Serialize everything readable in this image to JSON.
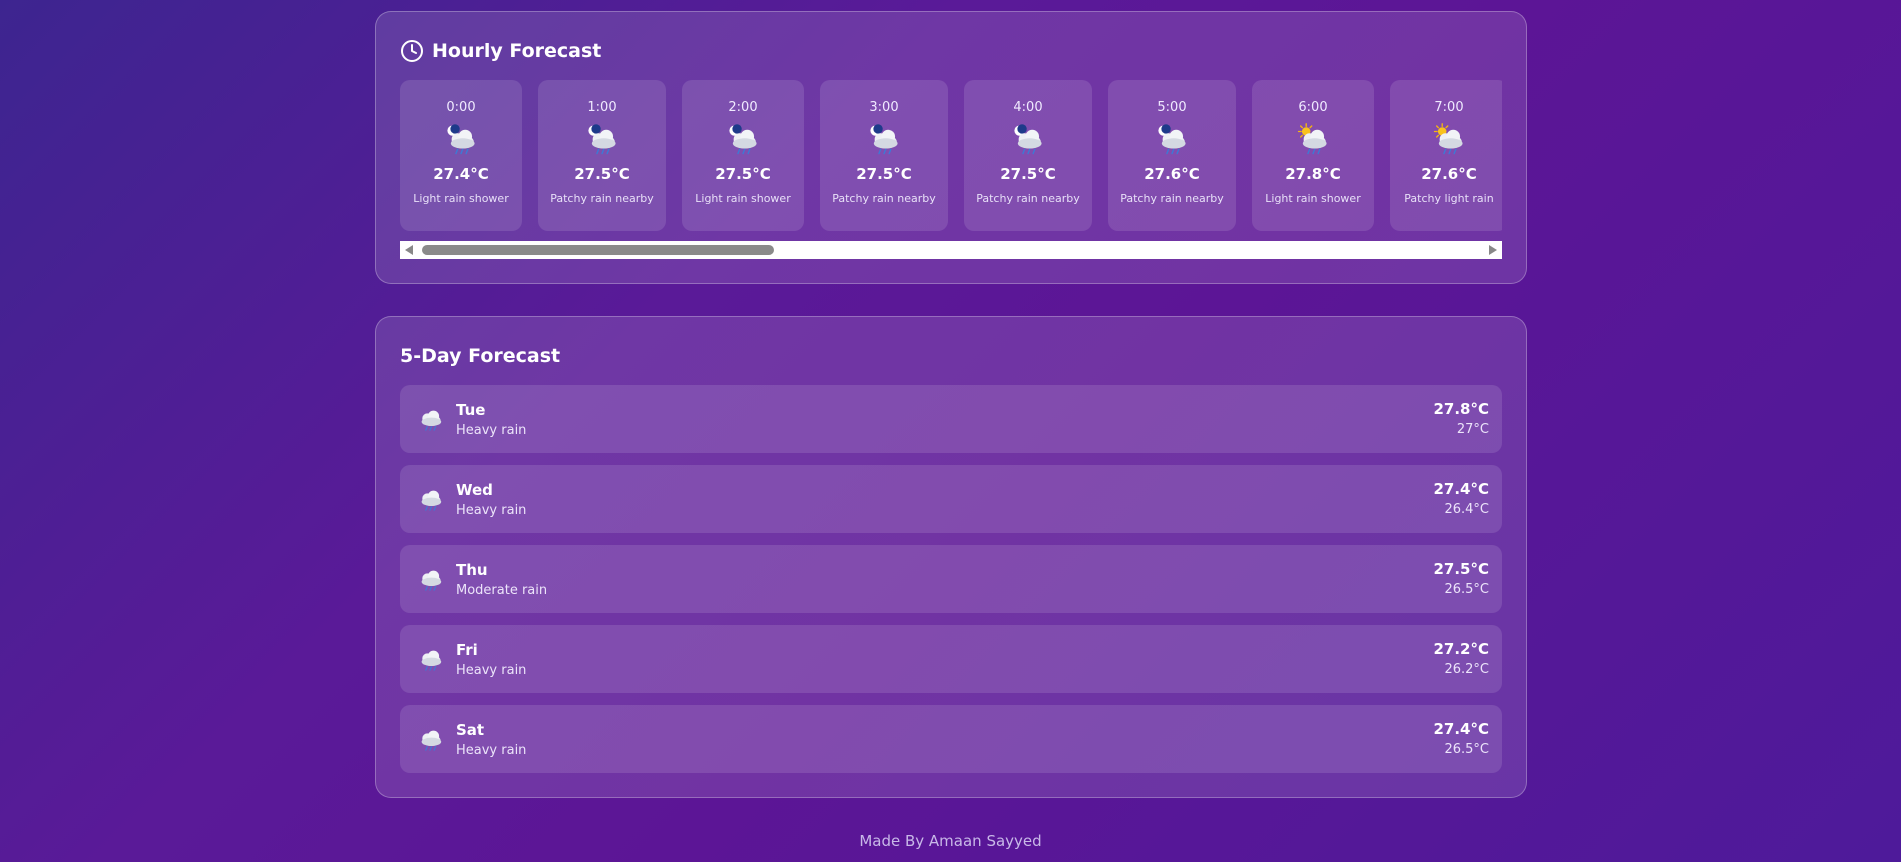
{
  "hourly": {
    "title": "Hourly Forecast",
    "title_icon": "clock-icon",
    "items": [
      {
        "time": "0:00",
        "icon": "moon-cloud-rain-icon",
        "temp": "27.4°C",
        "condition": "Light rain shower"
      },
      {
        "time": "1:00",
        "icon": "moon-cloud-rain-icon",
        "temp": "27.5°C",
        "condition": "Patchy rain nearby"
      },
      {
        "time": "2:00",
        "icon": "moon-cloud-rain-icon",
        "temp": "27.5°C",
        "condition": "Light rain shower"
      },
      {
        "time": "3:00",
        "icon": "moon-cloud-rain-icon",
        "temp": "27.5°C",
        "condition": "Patchy rain nearby"
      },
      {
        "time": "4:00",
        "icon": "moon-cloud-rain-icon",
        "temp": "27.5°C",
        "condition": "Patchy rain nearby"
      },
      {
        "time": "5:00",
        "icon": "moon-cloud-rain-icon",
        "temp": "27.6°C",
        "condition": "Patchy rain nearby"
      },
      {
        "time": "6:00",
        "icon": "sun-cloud-rain-icon",
        "temp": "27.8°C",
        "condition": "Light rain shower"
      },
      {
        "time": "7:00",
        "icon": "sun-cloud-rain-icon",
        "temp": "27.6°C",
        "condition": "Patchy light rain"
      }
    ]
  },
  "daily": {
    "title": "5-Day Forecast",
    "items": [
      {
        "day": "Tue",
        "icon": "cloud-rain-icon",
        "condition": "Heavy rain",
        "max": "27.8°C",
        "min": "27°C"
      },
      {
        "day": "Wed",
        "icon": "cloud-rain-icon",
        "condition": "Heavy rain",
        "max": "27.4°C",
        "min": "26.4°C"
      },
      {
        "day": "Thu",
        "icon": "cloud-rain-icon",
        "condition": "Moderate rain",
        "max": "27.5°C",
        "min": "26.5°C"
      },
      {
        "day": "Fri",
        "icon": "cloud-rain-icon",
        "condition": "Heavy rain",
        "max": "27.2°C",
        "min": "26.2°C"
      },
      {
        "day": "Sat",
        "icon": "cloud-rain-icon",
        "condition": "Heavy rain",
        "max": "27.4°C",
        "min": "26.5°C"
      }
    ]
  },
  "footer": {
    "text": "Made By Amaan Sayyed"
  },
  "colors": {
    "background_start": "#3d2590",
    "background_mid": "#5a1a98",
    "panel": "rgba(255,255,255,0.13)",
    "scroll_thumb": "#8a8a8a"
  }
}
